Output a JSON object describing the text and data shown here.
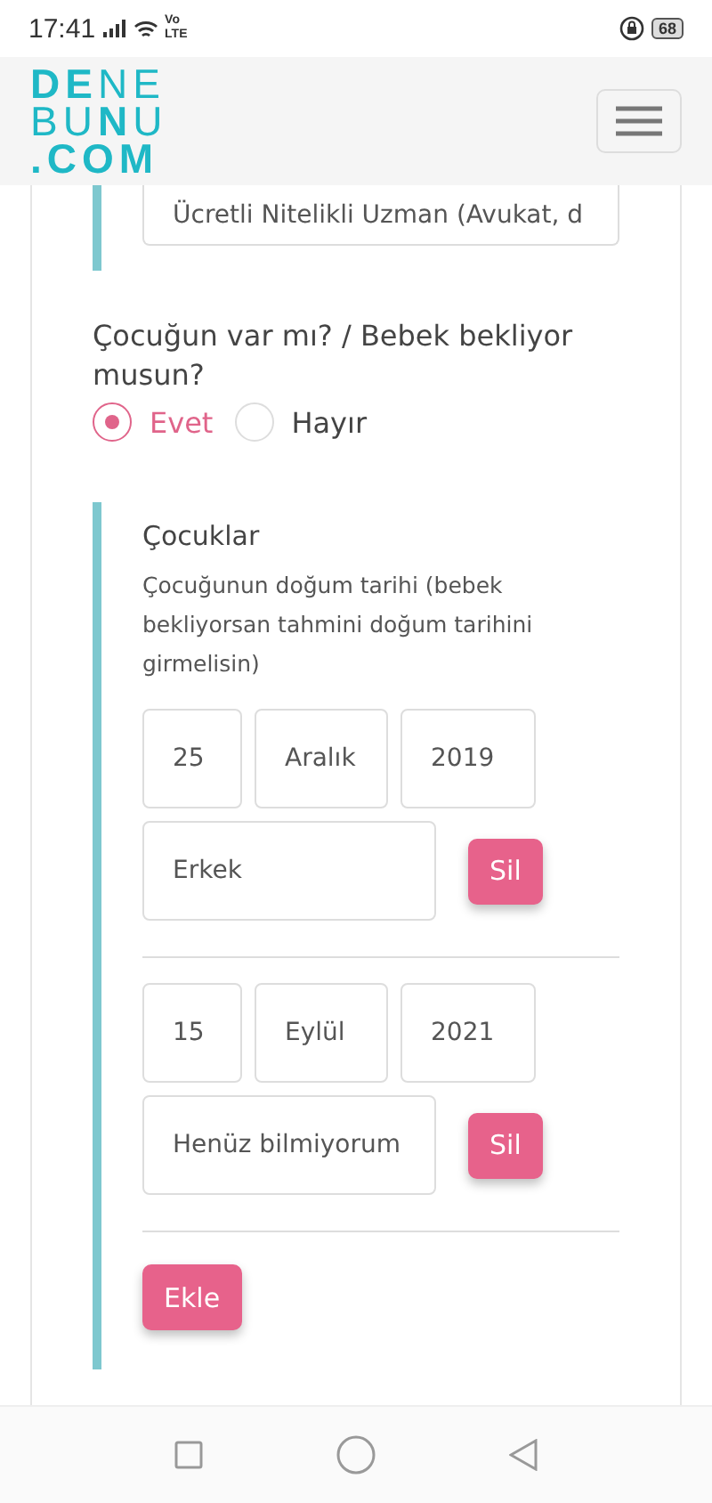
{
  "status_bar": {
    "time": "17:41",
    "network_top": "Vo",
    "network_bottom": "LTE",
    "battery": "68"
  },
  "header": {
    "logo_lines": [
      "**DE**NE",
      "BU**N**U",
      ".COM"
    ]
  },
  "previous_field": {
    "value": "Ücretli Nitelikli Uzman (Avukat, d"
  },
  "question": {
    "label": "Çocuğun var mı? / Bebek bekliyor musun?",
    "options": [
      {
        "label": "Evet",
        "selected": true
      },
      {
        "label": "Hayır",
        "selected": false
      }
    ]
  },
  "children_section": {
    "title": "Çocuklar",
    "hint": "Çocuğunun doğum tarihi (bebek bekliyorsan tahmini doğum tarihini girmelisin)",
    "children": [
      {
        "day": "25",
        "month": "Aralık",
        "year": "2019",
        "gender": "Erkek",
        "remove_button": "Sil"
      },
      {
        "day": "15",
        "month": "Eylül",
        "year": "2021",
        "gender": "Henüz bilmiyorum",
        "remove_button": "Sil"
      }
    ],
    "add_button": "Ekle"
  }
}
